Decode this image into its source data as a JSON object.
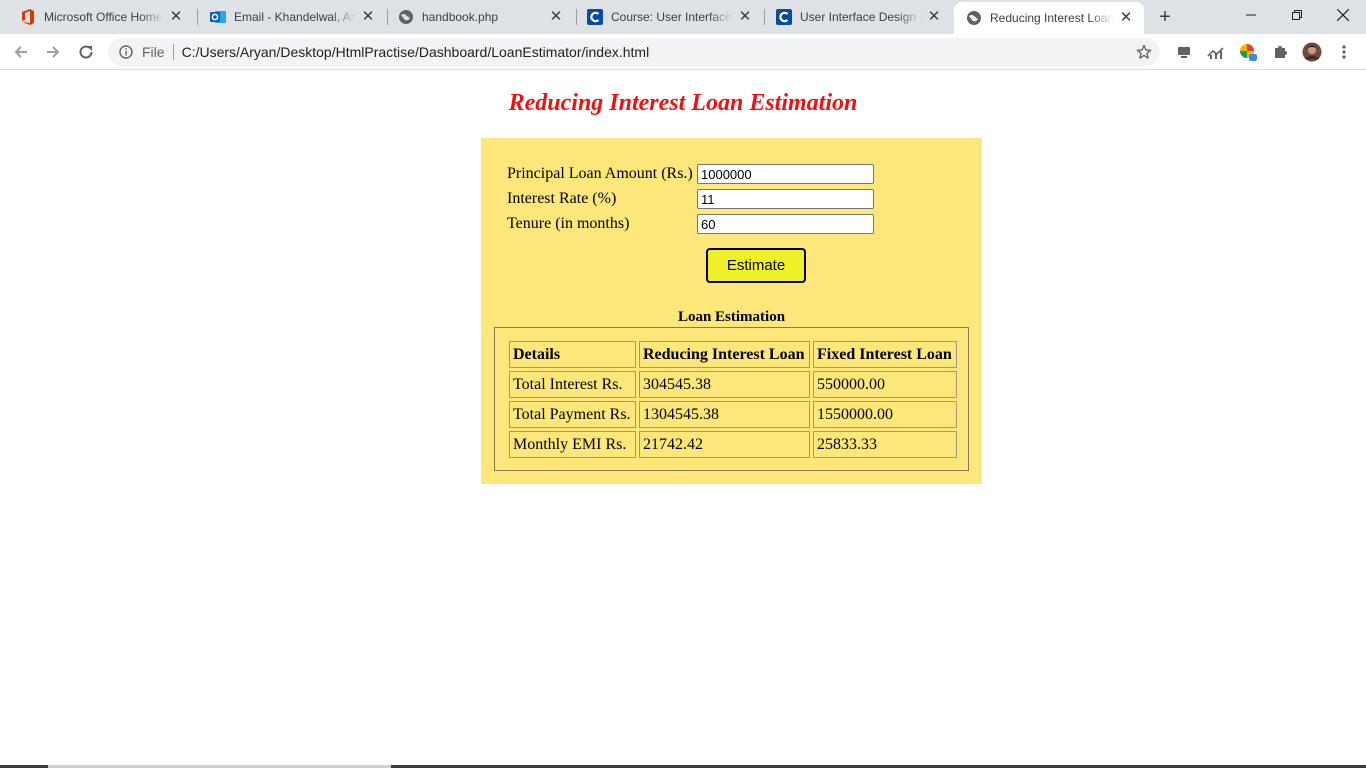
{
  "browser": {
    "tabs": [
      {
        "title": "Microsoft Office Home",
        "icon": "office-icon"
      },
      {
        "title": "Email - Khandelwal, Aryan",
        "icon": "outlook-icon"
      },
      {
        "title": "handbook.php",
        "icon": "globe-icon"
      },
      {
        "title": "Course: User Interface Design",
        "icon": "course-c-icon"
      },
      {
        "title": "User Interface Design Fundamentals",
        "icon": "course-c-icon"
      },
      {
        "title": "Reducing Interest Loan Estimation",
        "icon": "globe-icon",
        "active": true
      }
    ],
    "new_tab_label": "+",
    "address": {
      "scheme_label": "File",
      "url": "C:/Users/Aryan/Desktop/HtmlPractise/Dashboard/LoanEstimator/index.html"
    }
  },
  "page": {
    "title": "Reducing Interest Loan Estimation",
    "form": {
      "principal_label": "Principal Loan Amount (Rs.)",
      "principal_value": "1000000",
      "rate_label": "Interest Rate (%)",
      "rate_value": "11",
      "tenure_label": "Tenure (in months)",
      "tenure_value": "60",
      "button_label": "Estimate"
    },
    "results": {
      "caption": "Loan Estimation",
      "headers": [
        "Details",
        "Reducing Interest Loan",
        "Fixed Interest Loan"
      ],
      "rows": [
        [
          "Total Interest Rs.",
          "304545.38",
          "550000.00"
        ],
        [
          "Total Payment Rs.",
          "1304545.38",
          "1550000.00"
        ],
        [
          "Monthly EMI Rs.",
          "21742.42",
          "25833.33"
        ]
      ]
    }
  },
  "colors": {
    "title": "#ee1111",
    "panel": "#fde67a",
    "button": "#f0f029"
  }
}
